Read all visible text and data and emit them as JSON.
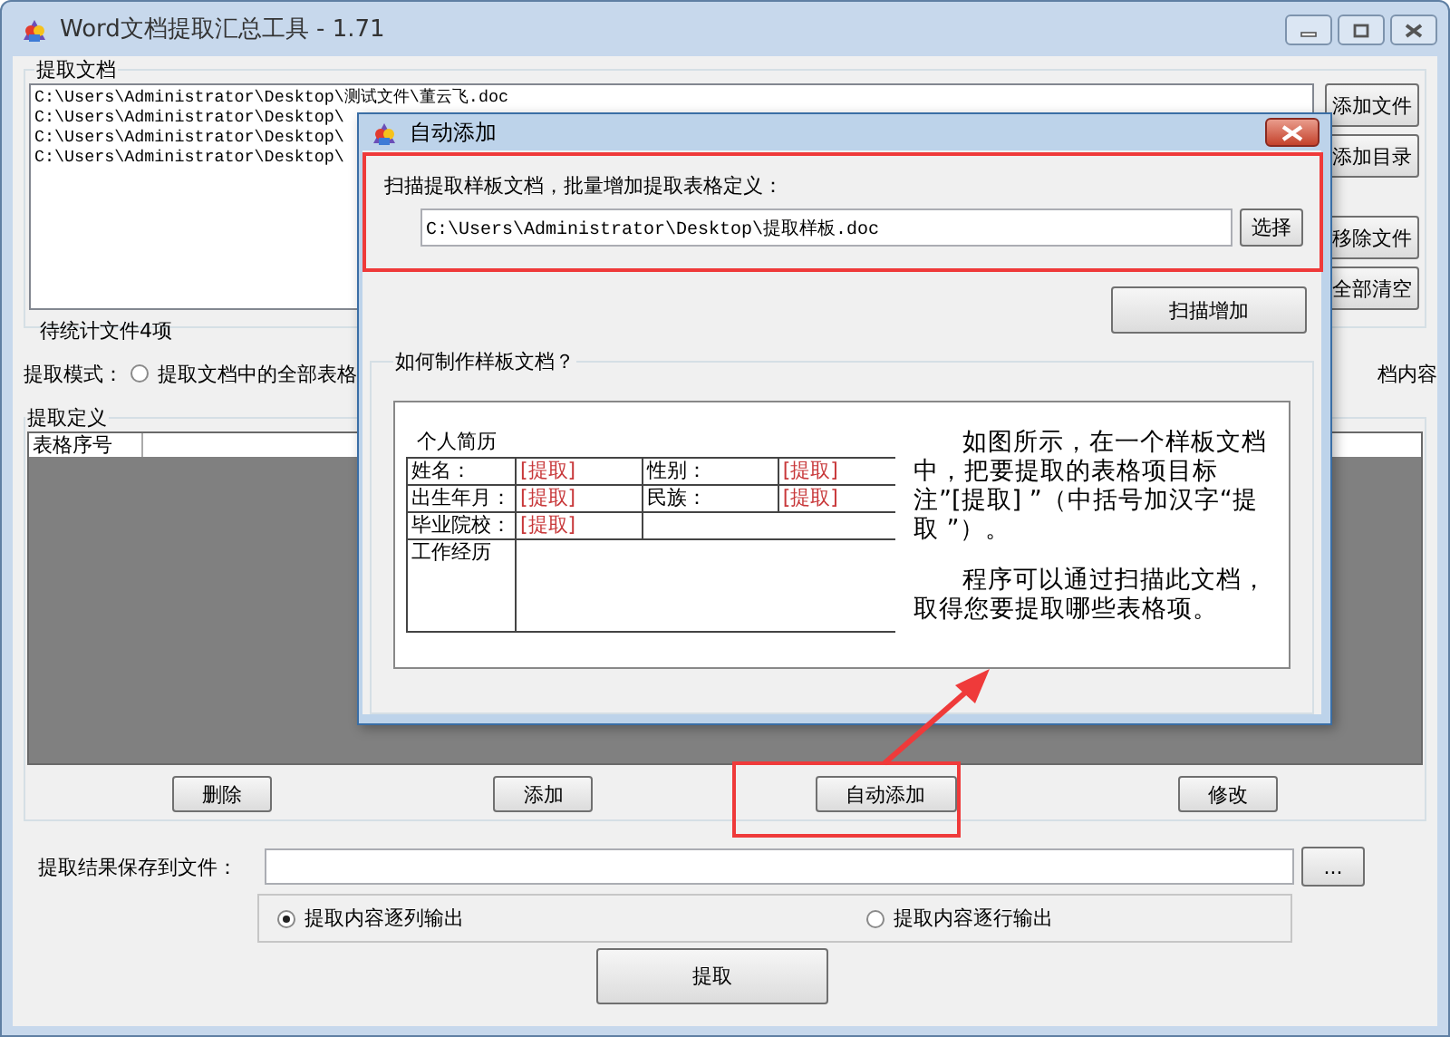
{
  "window": {
    "title": "Word文档提取汇总工具 - 1.71"
  },
  "documents": {
    "title": "提取文档",
    "files": [
      "C:\\Users\\Administrator\\Desktop\\测试文件\\董云飞.doc",
      "C:\\Users\\Administrator\\Desktop\\",
      "C:\\Users\\Administrator\\Desktop\\",
      "C:\\Users\\Administrator\\Desktop\\"
    ],
    "count": "待统计文件4项",
    "buttons": [
      "添加文件",
      "添加目录",
      "移除文件",
      "全部清空"
    ]
  },
  "mode": {
    "label": "提取模式：",
    "options": [
      {
        "label": "提取文档中的全部表格",
        "selected": false
      }
    ],
    "trailing_text": "档内容"
  },
  "definitions": {
    "title": "提取定义",
    "columns": [
      "表格序号"
    ],
    "buttons": [
      "删除",
      "添加",
      "自动添加",
      "修改"
    ]
  },
  "output": {
    "label": "提取结果保存到文件：",
    "browse_button": "...",
    "options": [
      {
        "label": "提取内容逐列输出",
        "selected": true
      },
      {
        "label": "提取内容逐行输出",
        "selected": false
      }
    ],
    "run_button": "提取"
  },
  "dialog": {
    "title": "自动添加",
    "prompt": "扫描提取样板文档，批量增加提取表格定义：",
    "path": "C:\\Users\\Administrator\\Desktop\\提取样板.doc",
    "choose_button": "选择",
    "scan_button": "扫描增加",
    "help": {
      "title": "如何制作样板文档？",
      "sample": {
        "heading": "个人简历",
        "rows": [
          [
            {
              "kind": "label",
              "text": "姓名："
            },
            {
              "kind": "field",
              "text": "[提取]"
            },
            {
              "kind": "label",
              "text": "性别："
            },
            {
              "kind": "field",
              "text": "[提取]"
            }
          ],
          [
            {
              "kind": "label",
              "text": "出生年月："
            },
            {
              "kind": "field",
              "text": "[提取]"
            },
            {
              "kind": "label",
              "text": "民族："
            },
            {
              "kind": "field",
              "text": "[提取]"
            }
          ],
          [
            {
              "kind": "label",
              "text": "毕业院校："
            },
            {
              "kind": "field",
              "text": "[提取]"
            }
          ],
          [
            {
              "kind": "label",
              "text": "工作经历"
            }
          ]
        ]
      },
      "paragraphs": [
        "如图所示，在一个样板文档中，把要提取的表格项目标注”[提取] ”（中括号加汉字“提取 ”）。",
        "程序可以通过扫描此文档，取得您要提取哪些表格项。"
      ]
    }
  }
}
